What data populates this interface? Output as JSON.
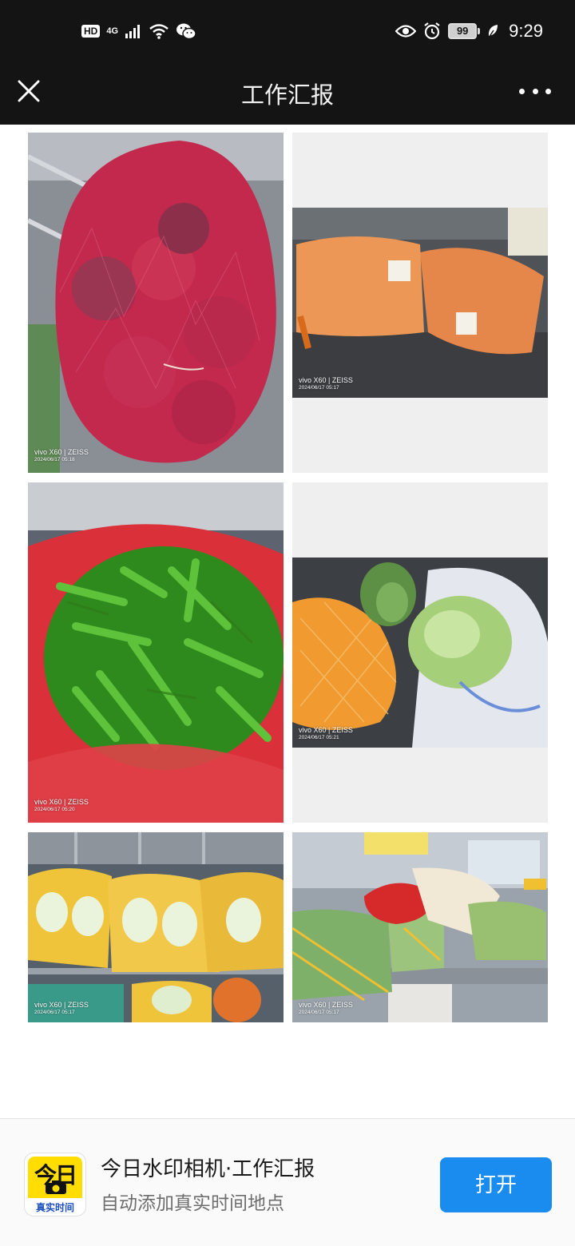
{
  "status_bar": {
    "hd": "HD",
    "network": "4G",
    "battery": "99",
    "time": "9:29"
  },
  "nav": {
    "title": "工作汇报"
  },
  "photos": [
    {
      "brand": "vivo X60 | ZEISS",
      "date": "2024/06/17 05:18",
      "subject": "red onions in mesh bag"
    },
    {
      "brand": "vivo X60 | ZEISS",
      "date": "2024/06/17 05:17",
      "subject": "bagged carrots"
    },
    {
      "brand": "vivo X60 | ZEISS",
      "date": "2024/06/17 05:20",
      "subject": "green peppers in red bag"
    },
    {
      "brand": "vivo X60 | ZEISS",
      "date": "2024/06/17 05:21",
      "subject": "cabbage and netted melon"
    },
    {
      "brand": "vivo X60 | ZEISS",
      "date": "2024/06/17 05:17",
      "subject": "napa cabbage bags"
    },
    {
      "brand": "vivo X60 | ZEISS",
      "date": "2024/06/17 05:17",
      "subject": "vegetables on counter"
    }
  ],
  "app_banner": {
    "icon_text": "今日",
    "icon_caption": "真实时间",
    "title": "今日水印相机·工作汇报",
    "subtitle": "自动添加真实时间地点",
    "open_label": "打开"
  },
  "colors": {
    "header_bg": "#141414",
    "open_button": "#1a8cf0",
    "app_icon_yellow": "#ffdd00"
  }
}
